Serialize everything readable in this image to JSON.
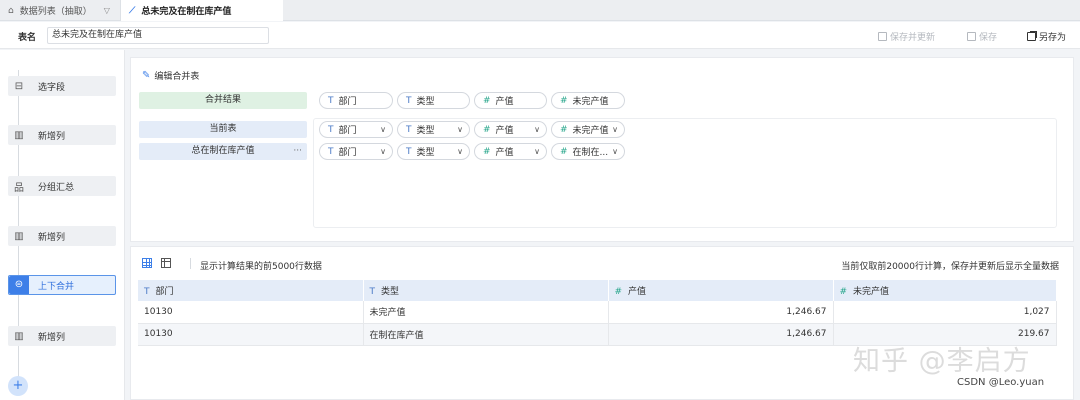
{
  "tabs": [
    {
      "label": "数据列表（抽取）",
      "icon": "home-icon"
    },
    {
      "label": "总未完及在制在库产值",
      "icon": "chart-line-icon"
    }
  ],
  "namebar": {
    "label": "表名",
    "value": "总未完及在制在库产值",
    "save_update": "保存并更新",
    "save": "保存",
    "save_as": "另存为"
  },
  "steps": [
    {
      "label": "选字段",
      "icon": "select-field-icon"
    },
    {
      "label": "新增列",
      "icon": "add-column-icon"
    },
    {
      "label": "分组汇总",
      "icon": "group-icon"
    },
    {
      "label": "新增列",
      "icon": "add-column-icon"
    },
    {
      "label": "上下合并",
      "icon": "merge-icon"
    },
    {
      "label": "新增列",
      "icon": "add-column-icon"
    }
  ],
  "merge": {
    "edit_label": "编辑合并表",
    "result_label": "合并结果",
    "result_fields": [
      {
        "type": "T",
        "name": "部门"
      },
      {
        "type": "T",
        "name": "类型"
      },
      {
        "type": "#",
        "name": "产值"
      },
      {
        "type": "#",
        "name": "未完产值"
      }
    ],
    "tables": [
      {
        "label": "当前表",
        "fields": [
          {
            "type": "T",
            "name": "部门"
          },
          {
            "type": "T",
            "name": "类型"
          },
          {
            "type": "#",
            "name": "产值"
          },
          {
            "type": "#",
            "name": "未完产值"
          }
        ]
      },
      {
        "label": "总在制在库产值",
        "more": "···",
        "fields": [
          {
            "type": "T",
            "name": "部门"
          },
          {
            "type": "T",
            "name": "类型"
          },
          {
            "type": "#",
            "name": "产值"
          },
          {
            "type": "#",
            "name": "在制在..."
          }
        ]
      }
    ]
  },
  "preview": {
    "info_left": "显示计算结果的前5000行数据",
    "info_right": "当前仅取前20000行计算，保存并更新后显示全量数据",
    "columns": [
      {
        "type": "T",
        "name": "部门"
      },
      {
        "type": "T",
        "name": "类型"
      },
      {
        "type": "#",
        "name": "产值"
      },
      {
        "type": "#",
        "name": "未完产值"
      }
    ],
    "rows": [
      [
        "10130",
        "未完产值",
        "1,246.67",
        "1,027"
      ],
      [
        "10130",
        "在制在库产值",
        "1,246.67",
        "219.67"
      ]
    ]
  },
  "watermark": {
    "main": "知乎 @李启方",
    "csdn": "CSDN @Leo.yuan"
  },
  "colors": {
    "accent": "#3d7fe8",
    "number_type": "#25a58a",
    "text_type": "#4a79c6",
    "result_bg": "#dff1e3",
    "table_label_bg": "#e4ecf8"
  }
}
